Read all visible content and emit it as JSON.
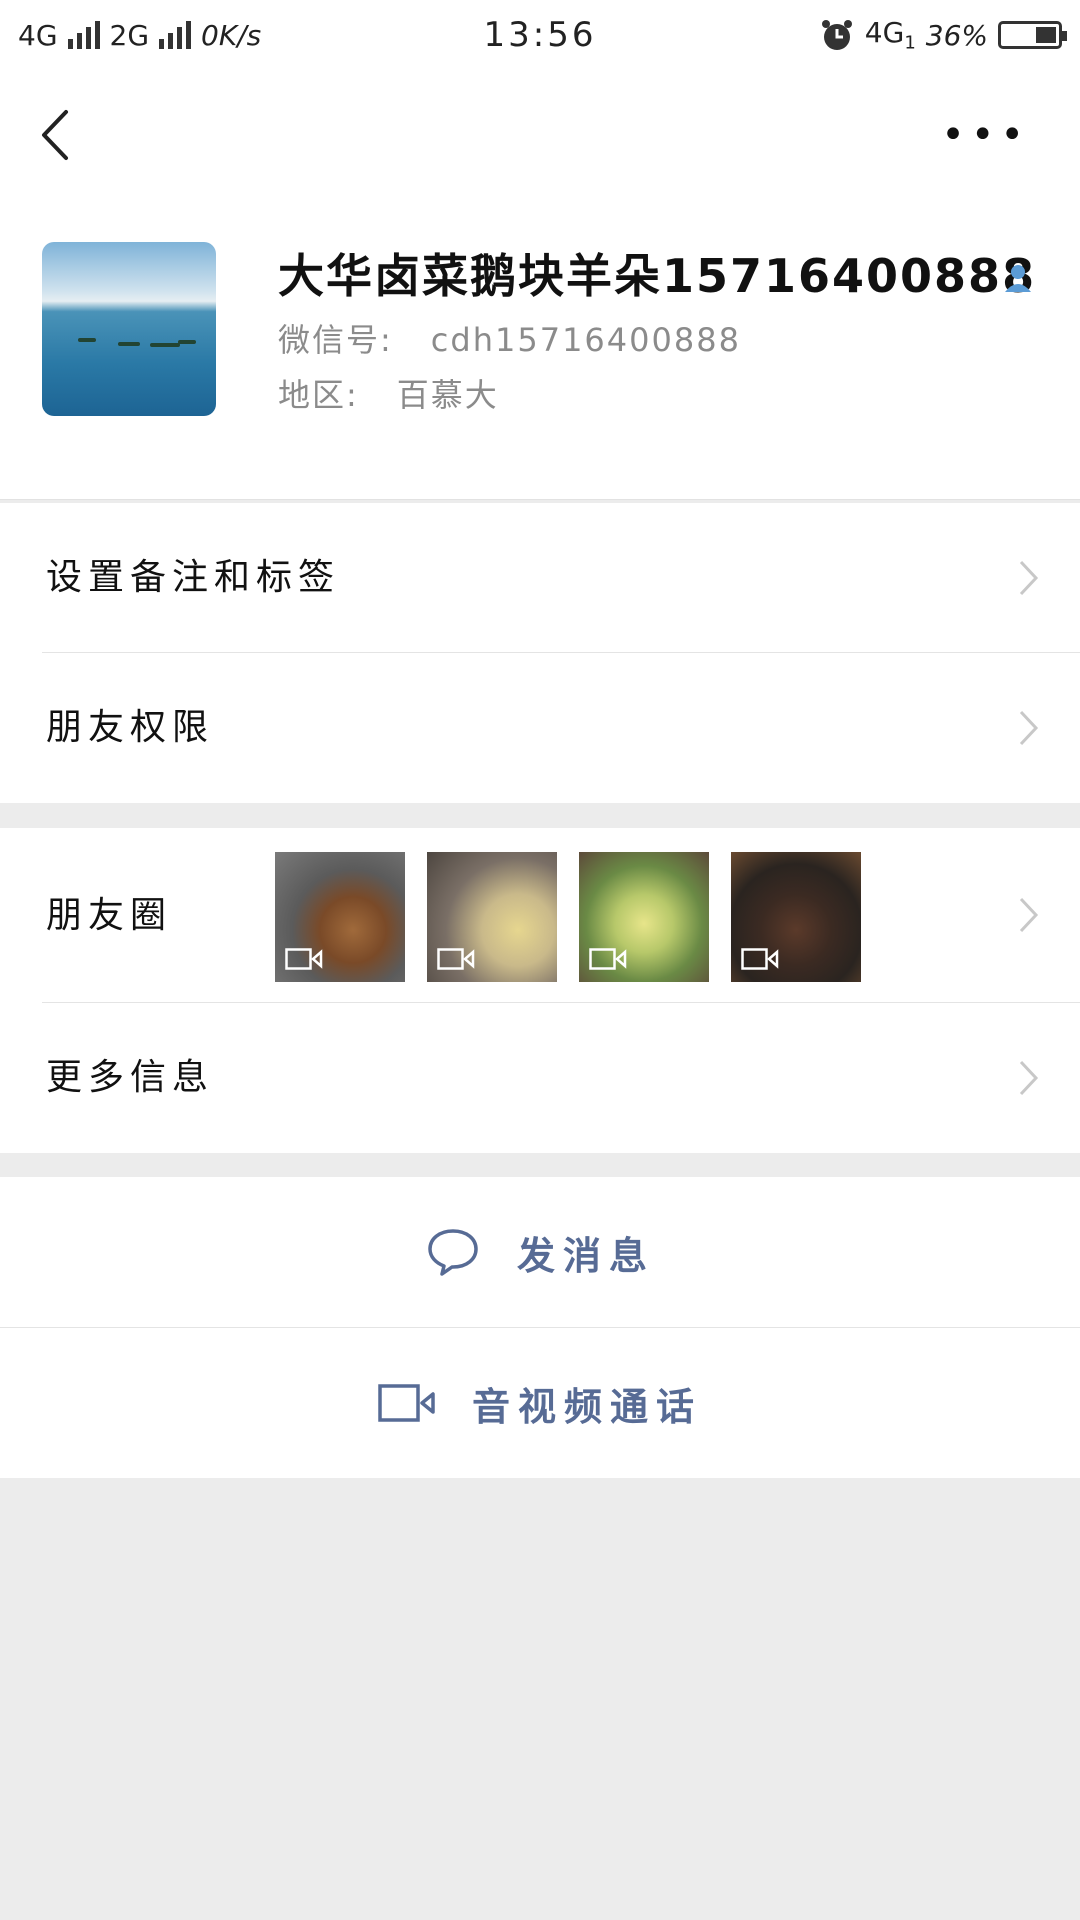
{
  "status_bar": {
    "net1": "4G",
    "net2": "2G",
    "speed": "0K/s",
    "time": "13:56",
    "net3": "4G",
    "net3_sub": "1",
    "battery": "36%"
  },
  "profile": {
    "name": "大华卤菜鹅块羊朵15716400888",
    "wechat_id_label": "微信号:",
    "wechat_id": "cdh15716400888",
    "region_label": "地区:",
    "region": "百慕大"
  },
  "menu": {
    "remark": "设置备注和标签",
    "permissions": "朋友权限",
    "moments": "朋友圈",
    "more_info": "更多信息"
  },
  "actions": {
    "message": "发消息",
    "call": "音视频通话"
  },
  "colors": {
    "link": "#576b95",
    "contact_icon": "#5b9bd5",
    "background": "#ececec"
  }
}
